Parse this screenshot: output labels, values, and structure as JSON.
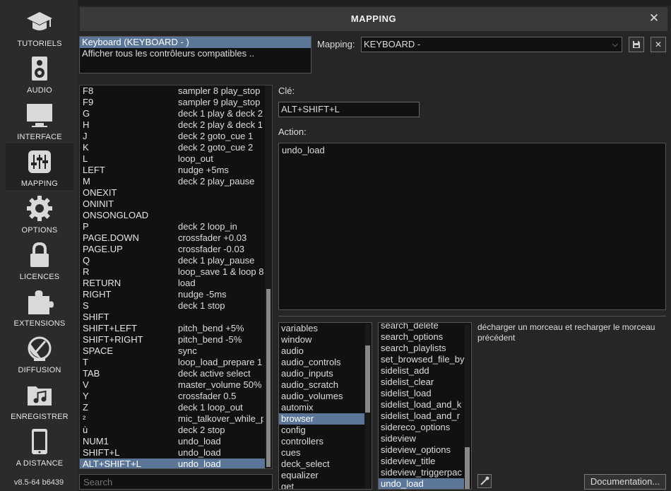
{
  "sidebar": {
    "items": [
      {
        "label": "TUTORIELS",
        "icon": "graduation-cap-icon"
      },
      {
        "label": "AUDIO",
        "icon": "speaker-icon"
      },
      {
        "label": "INTERFACE",
        "icon": "monitor-icon"
      },
      {
        "label": "MAPPING",
        "icon": "mixer-sliders-icon"
      },
      {
        "label": "OPTIONS",
        "icon": "gear-icon"
      },
      {
        "label": "LICENCES",
        "icon": "lock-icon"
      },
      {
        "label": "EXTENSIONS",
        "icon": "puzzle-icon"
      },
      {
        "label": "DIFFUSION",
        "icon": "satellite-dish-icon"
      },
      {
        "label": "ENREGISTRER",
        "icon": "music-folder-icon"
      },
      {
        "label": "A DISTANCE",
        "icon": "tablet-icon"
      }
    ],
    "version": "v8.5-64 b6439"
  },
  "dialog": {
    "title": "MAPPING",
    "close": "✕"
  },
  "controllers": [
    "Keyboard (KEYBOARD - )",
    "Afficher tous les contrôleurs compatibles .."
  ],
  "mapping": {
    "label": "Mapping:",
    "value": "KEYBOARD -"
  },
  "keys": [
    {
      "key": "F8",
      "action": "sampler  8 play_stop"
    },
    {
      "key": "F9",
      "action": "sampler  9 play_stop"
    },
    {
      "key": "G",
      "action": "deck 1 play & deck 2"
    },
    {
      "key": "H",
      "action": "deck 2 play & deck 1"
    },
    {
      "key": "J",
      "action": "deck 2 goto_cue 1"
    },
    {
      "key": "K",
      "action": "deck 2 goto_cue 2"
    },
    {
      "key": "L",
      "action": "loop_out"
    },
    {
      "key": "LEFT",
      "action": "nudge +5ms"
    },
    {
      "key": "M",
      "action": "deck 2 play_pause"
    },
    {
      "key": "ONEXIT",
      "action": ""
    },
    {
      "key": "ONINIT",
      "action": ""
    },
    {
      "key": "ONSONGLOAD",
      "action": ""
    },
    {
      "key": "P",
      "action": "deck 2 loop_in"
    },
    {
      "key": "PAGE.DOWN",
      "action": "crossfader +0.03"
    },
    {
      "key": "PAGE.UP",
      "action": "crossfader -0.03"
    },
    {
      "key": "Q",
      "action": "deck 1 play_pause"
    },
    {
      "key": "R",
      "action": "loop_save 1 & loop 8"
    },
    {
      "key": "RETURN",
      "action": "load"
    },
    {
      "key": "RIGHT",
      "action": "nudge -5ms"
    },
    {
      "key": "S",
      "action": "deck 1 stop"
    },
    {
      "key": "SHIFT",
      "action": ""
    },
    {
      "key": "SHIFT+LEFT",
      "action": "pitch_bend +5%"
    },
    {
      "key": "SHIFT+RIGHT",
      "action": "pitch_bend -5%"
    },
    {
      "key": "SPACE",
      "action": "sync"
    },
    {
      "key": "T",
      "action": "loop_load_prepare 1"
    },
    {
      "key": "TAB",
      "action": "deck active select"
    },
    {
      "key": "V",
      "action": "master_volume 50%"
    },
    {
      "key": "Y",
      "action": "crossfader 0.5"
    },
    {
      "key": "Z",
      "action": "deck 1 loop_out"
    },
    {
      "key": "²",
      "action": "mic_talkover_while_p"
    },
    {
      "key": "ù",
      "action": "deck 2 stop"
    },
    {
      "key": "NUM1",
      "action": "undo_load"
    },
    {
      "key": "SHIFT+L",
      "action": "undo_load"
    },
    {
      "key": "ALT+SHIFT+L",
      "action": "undo_load"
    }
  ],
  "search_placeholder": "Search",
  "editor": {
    "key_label": "Clé:",
    "key_value": "ALT+SHIFT+L",
    "action_label": "Action:",
    "action_value": "undo_load"
  },
  "categories": [
    "variables",
    "window",
    "audio",
    "audio_controls",
    "audio_inputs",
    "audio_scratch",
    "audio_volumes",
    "automix",
    "browser",
    "config",
    "controllers",
    "cues",
    "deck_select",
    "equalizer",
    "get"
  ],
  "selected_category": "browser",
  "commands": [
    "search_delete",
    "search_options",
    "search_playlists",
    "set_browsed_file_by",
    "sidelist_add",
    "sidelist_clear",
    "sidelist_load",
    "sidelist_load_and_k",
    "sidelist_load_and_r",
    "sidereco_options",
    "sideview",
    "sideview_options",
    "sideview_title",
    "sideview_triggerpac",
    "undo_load"
  ],
  "selected_command": "undo_load",
  "description": "décharger un morceau et recharger le morceau précédent",
  "doc_button": "Documentation...",
  "colors": {
    "selection": "#5c7699",
    "background": "#1e1e1e",
    "panel": "#262626"
  }
}
